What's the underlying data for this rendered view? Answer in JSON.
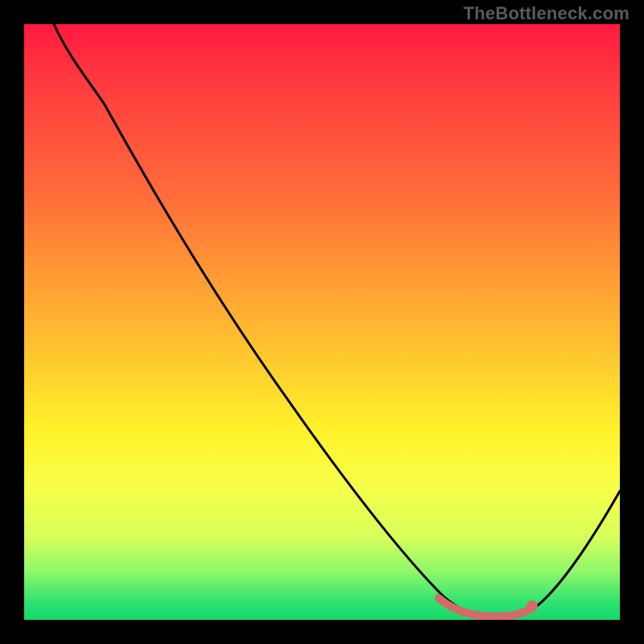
{
  "watermark": "TheBottleneck.com",
  "chart_data": {
    "type": "line",
    "title": "",
    "xlabel": "",
    "ylabel": "",
    "xlim": [
      0,
      100
    ],
    "ylim": [
      0,
      100
    ],
    "grid": false,
    "legend": false,
    "background_gradient": {
      "orientation": "vertical",
      "stops": [
        {
          "pos": 0,
          "color": "#ff1a3f"
        },
        {
          "pos": 28,
          "color": "#ff6a3a"
        },
        {
          "pos": 56,
          "color": "#ffc82f"
        },
        {
          "pos": 78,
          "color": "#f7ff4a"
        },
        {
          "pos": 97,
          "color": "#2fe36f"
        },
        {
          "pos": 100,
          "color": "#17d86b"
        }
      ]
    },
    "series": [
      {
        "name": "bottleneck-curve",
        "color": "#000000",
        "x": [
          5,
          10,
          15,
          20,
          25,
          30,
          35,
          40,
          45,
          50,
          55,
          60,
          65,
          70,
          75,
          80,
          82,
          85,
          90,
          95,
          100
        ],
        "y": [
          100,
          95,
          90,
          83,
          75,
          67.5,
          60,
          52.5,
          45,
          37.5,
          30,
          22.5,
          15,
          8,
          3,
          0.5,
          0.5,
          1,
          5,
          12,
          22
        ]
      },
      {
        "name": "optimal-range",
        "color": "#d46a6a",
        "x": [
          70,
          72,
          75,
          78,
          80,
          82,
          84
        ],
        "y": [
          3.0,
          1.5,
          0.8,
          0.5,
          0.5,
          0.8,
          2.0
        ]
      }
    ],
    "accent_point": {
      "x": 84,
      "y": 2.0,
      "color": "#d46a6a"
    }
  }
}
